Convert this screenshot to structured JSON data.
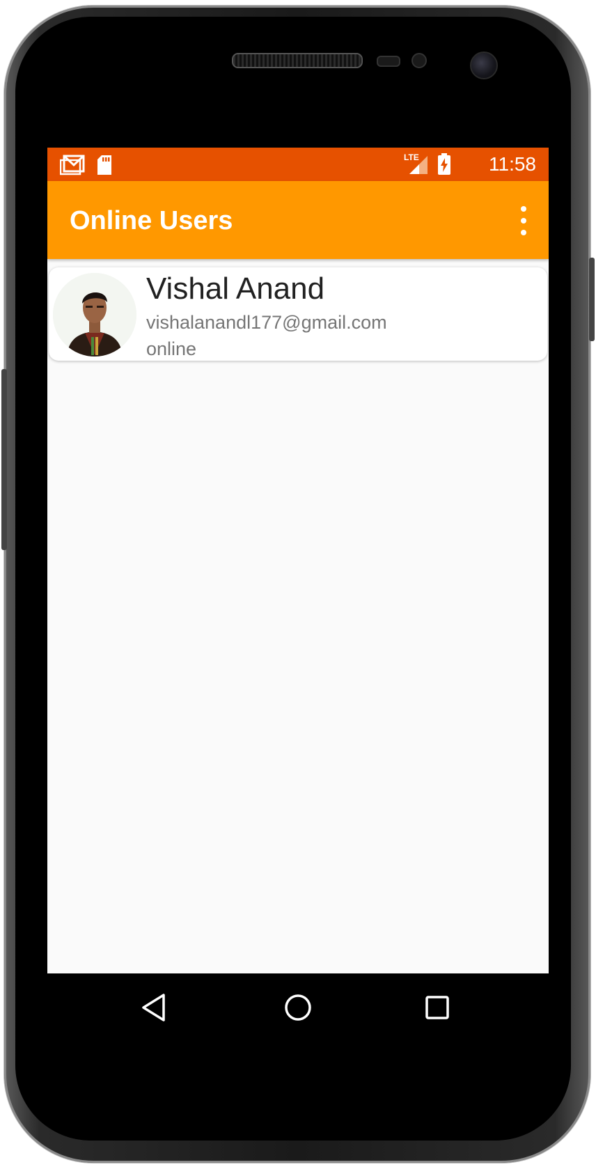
{
  "status_bar": {
    "time": "11:58",
    "network_label": "LTE",
    "icons": [
      "gmail-icon",
      "sd-card-icon",
      "lte-signal-icon",
      "battery-charging-icon"
    ],
    "color": "#e65100"
  },
  "app_bar": {
    "title": "Online Users",
    "color": "#ff9800",
    "overflow_icon": "more-vert-icon"
  },
  "users": [
    {
      "name": "Vishal Anand",
      "email": "vishalanandl177@gmail.com",
      "status": "online"
    }
  ],
  "navigation": {
    "buttons": [
      "back-icon",
      "home-icon",
      "recents-icon"
    ]
  }
}
